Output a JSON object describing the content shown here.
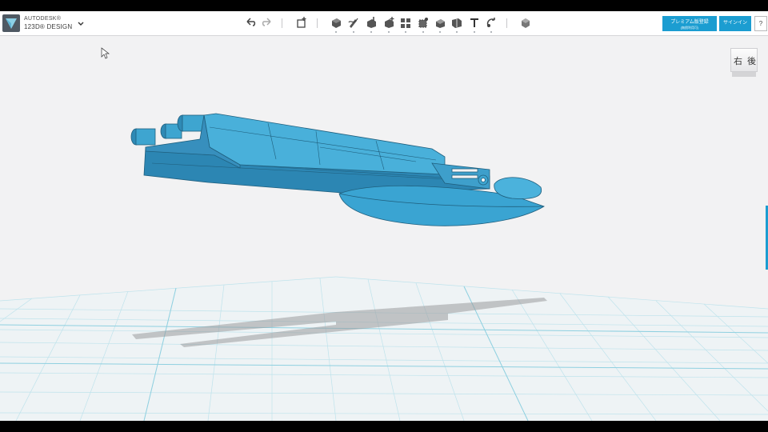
{
  "app": {
    "brand_line1": "AUTODESK®",
    "brand_line2": "123D® DESIGN"
  },
  "toolbar": {
    "icons": [
      "undo-icon",
      "redo-icon",
      "add-box-icon",
      "primitives-icon",
      "sketch-icon",
      "construct-icon",
      "modify-icon",
      "pattern-icon",
      "group-icon",
      "combine-icon",
      "measure-icon",
      "text-icon",
      "snap-icon",
      "material-icon"
    ]
  },
  "header": {
    "premium_label": "プレミアム版登録",
    "premium_sub": "(無償利用可)",
    "signin_label": "サインイン",
    "help_label": "?"
  },
  "viewcube": {
    "left_face": "右",
    "right_face": "後"
  },
  "colors": {
    "accent": "#1b9dd1",
    "model": "#3da3cf",
    "grid": "#a9dbe6"
  }
}
